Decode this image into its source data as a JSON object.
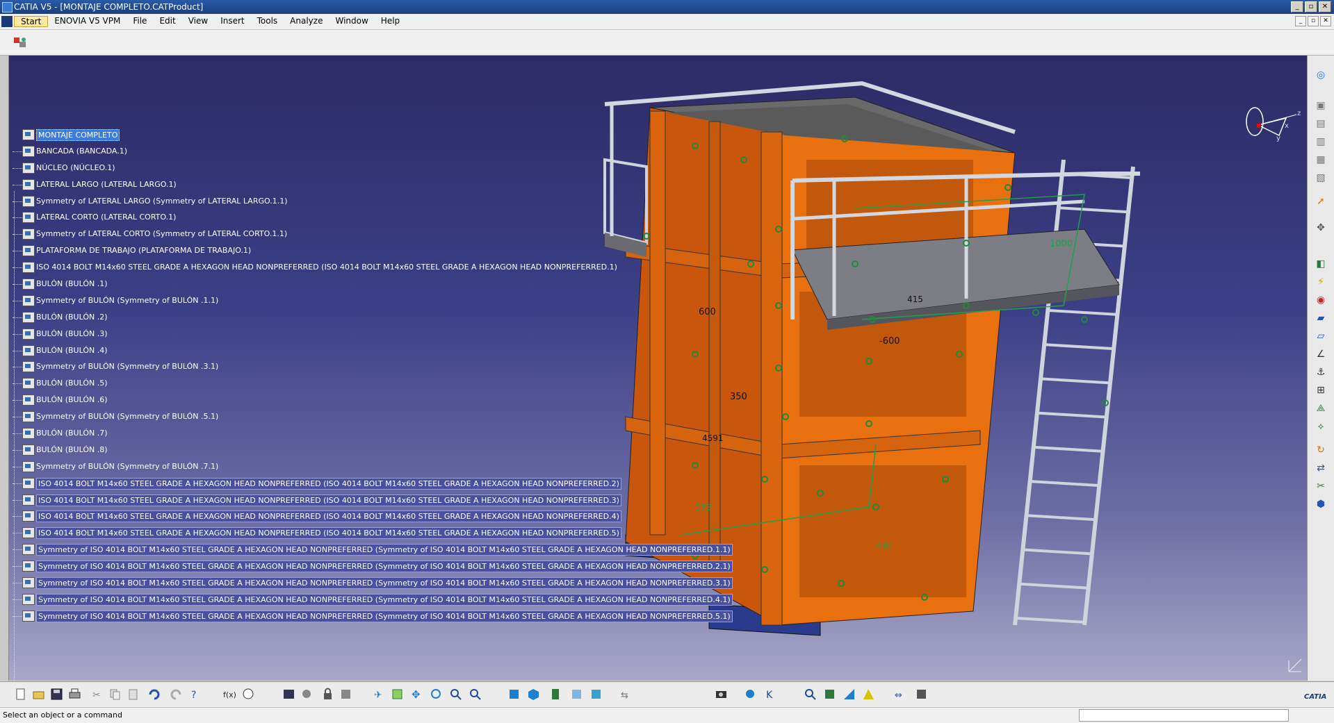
{
  "window": {
    "title": "CATIA V5 - [MONTAJE COMPLETO.CATProduct]",
    "buttons": [
      "_",
      "▫",
      "✕"
    ]
  },
  "menu": {
    "items": [
      "Start",
      "ENOVIA V5 VPM",
      "File",
      "Edit",
      "View",
      "Insert",
      "Tools",
      "Analyze",
      "Window",
      "Help"
    ],
    "mdi_buttons": [
      "_",
      "▫",
      "✕"
    ]
  },
  "tree": {
    "root": "MONTAJE COMPLETO",
    "nodes": [
      {
        "label": "BANCADA (BANCADA.1)",
        "highlight": false
      },
      {
        "label": "NÚCLEO (NÚCLEO.1)",
        "highlight": false
      },
      {
        "label": "LATERAL LARGO (LATERAL LARGO.1)",
        "highlight": false
      },
      {
        "label": "Symmetry of LATERAL LARGO (Symmetry of LATERAL LARGO.1.1)",
        "highlight": false
      },
      {
        "label": "LATERAL CORTO (LATERAL CORTO.1)",
        "highlight": false
      },
      {
        "label": "Symmetry of LATERAL CORTO (Symmetry of LATERAL CORTO.1.1)",
        "highlight": false
      },
      {
        "label": "PLATAFORMA DE TRABAJO (PLATAFORMA DE TRABAJO.1)",
        "highlight": false
      },
      {
        "label": "ISO 4014 BOLT M14x60 STEEL GRADE A HEXAGON HEAD NONPREFERRED (ISO 4014 BOLT M14x60 STEEL GRADE A HEXAGON HEAD NONPREFERRED.1)",
        "highlight": false
      },
      {
        "label": "BULÓN  (BULÓN .1)",
        "highlight": false
      },
      {
        "label": "Symmetry of BULÓN  (Symmetry of BULÓN .1.1)",
        "highlight": false
      },
      {
        "label": "BULÓN  (BULÓN .2)",
        "highlight": false
      },
      {
        "label": "BULÓN  (BULÓN .3)",
        "highlight": false
      },
      {
        "label": "BULÓN  (BULÓN .4)",
        "highlight": false
      },
      {
        "label": "Symmetry of BULÓN  (Symmetry of BULÓN .3.1)",
        "highlight": false
      },
      {
        "label": "BULÓN  (BULÓN .5)",
        "highlight": false
      },
      {
        "label": "BULÓN  (BULÓN .6)",
        "highlight": false
      },
      {
        "label": "Symmetry of BULÓN  (Symmetry of BULÓN .5.1)",
        "highlight": false
      },
      {
        "label": "BULÓN  (BULÓN .7)",
        "highlight": false
      },
      {
        "label": "BULÓN  (BULÓN .8)",
        "highlight": false
      },
      {
        "label": "Symmetry of BULÓN  (Symmetry of BULÓN .7.1)",
        "highlight": false
      },
      {
        "label": "ISO 4014 BOLT M14x60 STEEL GRADE A HEXAGON HEAD NONPREFERRED (ISO 4014 BOLT M14x60 STEEL GRADE A HEXAGON HEAD NONPREFERRED.2)",
        "highlight": true
      },
      {
        "label": "ISO 4014 BOLT M14x60 STEEL GRADE A HEXAGON HEAD NONPREFERRED (ISO 4014 BOLT M14x60 STEEL GRADE A HEXAGON HEAD NONPREFERRED.3)",
        "highlight": true
      },
      {
        "label": "ISO 4014 BOLT M14x60 STEEL GRADE A HEXAGON HEAD NONPREFERRED (ISO 4014 BOLT M14x60 STEEL GRADE A HEXAGON HEAD NONPREFERRED.4)",
        "highlight": true
      },
      {
        "label": "ISO 4014 BOLT M14x60 STEEL GRADE A HEXAGON HEAD NONPREFERRED (ISO 4014 BOLT M14x60 STEEL GRADE A HEXAGON HEAD NONPREFERRED.5)",
        "highlight": true
      },
      {
        "label": "Symmetry of ISO 4014 BOLT M14x60 STEEL GRADE A HEXAGON HEAD NONPREFERRED (Symmetry of ISO 4014 BOLT M14x60 STEEL GRADE A HEXAGON HEAD NONPREFERRED.1.1)",
        "highlight": true
      },
      {
        "label": "Symmetry of ISO 4014 BOLT M14x60 STEEL GRADE A HEXAGON HEAD NONPREFERRED (Symmetry of ISO 4014 BOLT M14x60 STEEL GRADE A HEXAGON HEAD NONPREFERRED.2.1)",
        "highlight": true
      },
      {
        "label": "Symmetry of ISO 4014 BOLT M14x60 STEEL GRADE A HEXAGON HEAD NONPREFERRED (Symmetry of ISO 4014 BOLT M14x60 STEEL GRADE A HEXAGON HEAD NONPREFERRED.3.1)",
        "highlight": true
      },
      {
        "label": "Symmetry of ISO 4014 BOLT M14x60 STEEL GRADE A HEXAGON HEAD NONPREFERRED (Symmetry of ISO 4014 BOLT M14x60 STEEL GRADE A HEXAGON HEAD NONPREFERRED.4.1)",
        "highlight": true
      },
      {
        "label": "Symmetry of ISO 4014 BOLT M14x60 STEEL GRADE A HEXAGON HEAD NONPREFERRED (Symmetry of ISO 4014 BOLT M14x60 STEEL GRADE A HEXAGON HEAD NONPREFERRED.5.1)",
        "highlight": true
      }
    ]
  },
  "model": {
    "dims": [
      "600",
      "-600",
      "350",
      "1000",
      "415",
      "4591",
      "575",
      "440"
    ],
    "axis_labels": [
      "x",
      "y",
      "z"
    ]
  },
  "status": {
    "message": "Select an object or a command"
  },
  "brand": "CATIA",
  "colors": {
    "viewport_top": "#2d2b66",
    "viewport_bottom": "#a9a8c8",
    "frame_orange": "#e8700f",
    "constraint_green": "#1f8a3a",
    "tree_highlight": "#4a50a0"
  }
}
